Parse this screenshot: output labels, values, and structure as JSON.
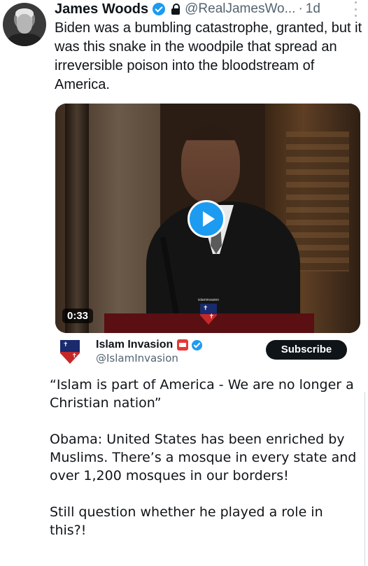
{
  "tweet": {
    "author_name": "James Woods",
    "handle": "@RealJamesWo...",
    "separator": "·",
    "time": "1d",
    "text": "Biden was a bumbling catastrophe, granted, but it was this snake in the woodpile that spread an irreversible poison into the bloodstream of America.",
    "icons": [
      "verified-badge-icon",
      "lock-icon",
      "more-icon"
    ]
  },
  "video": {
    "duration": "0:33",
    "play_icon": "play-icon",
    "watermark": "islaminvasion"
  },
  "quoted_card": {
    "name": "Islam Invasion",
    "handle": "@IslamInvasion",
    "subscribe_label": "Subscribe",
    "paragraphs": [
      "“Islam is part of America - We are no longer a Christian nation”",
      "Obama: United States has been enriched by Muslims. There’s a mosque in every state and over 1,200 mosques in our borders!",
      "Still question whether he played a role in this?!"
    ]
  },
  "colors": {
    "accent": "#1d9bf0",
    "text": "#0f1419",
    "secondary": "#536471"
  }
}
